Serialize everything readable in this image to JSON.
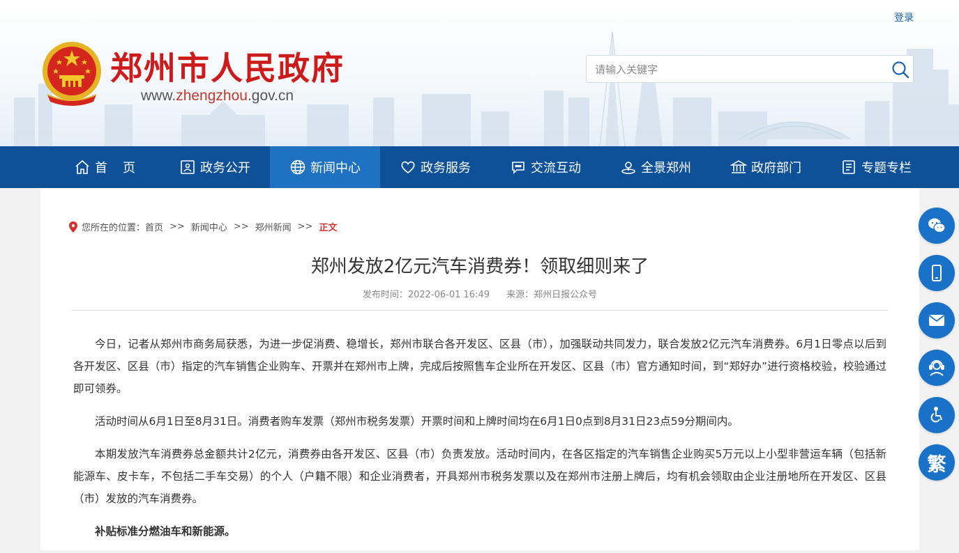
{
  "header": {
    "site_title": "郑州市人民政府",
    "domain_prefix": "www.",
    "domain_accent": "zhengzhou",
    "domain_suffix": ".gov.cn",
    "login_label": "登录",
    "search_placeholder": "请输入关键字",
    "search_icon": "search-icon"
  },
  "nav": {
    "items": [
      {
        "label": "首页",
        "icon": "home-icon"
      },
      {
        "label": "政务公开",
        "icon": "id-card-icon"
      },
      {
        "label": "新闻中心",
        "icon": "globe-icon",
        "active": true
      },
      {
        "label": "政务服务",
        "icon": "heart-icon"
      },
      {
        "label": "交流互动",
        "icon": "chat-icon"
      },
      {
        "label": "全景郑州",
        "icon": "panorama-icon"
      },
      {
        "label": "政府部门",
        "icon": "building-icon"
      },
      {
        "label": "专题专栏",
        "icon": "document-icon"
      }
    ]
  },
  "breadcrumb": {
    "prefix": "您所在的位置：",
    "items": [
      "首页",
      "新闻中心",
      "郑州新闻"
    ],
    "separator": ">>",
    "current": "正文"
  },
  "article": {
    "title": "郑州发放2亿元汽车消费券！领取细则来了",
    "publish_time": "发布时间：2022-06-01 16:49",
    "source": "来源：郑州日报公众号",
    "paragraphs": [
      "今日，记者从郑州市商务局获悉，为进一步促消费、稳增长，郑州市联合各开发区、区县（市），加强联动共同发力，联合发放2亿元汽车消费券。6月1日零点以后到各开发区、区县（市）指定的汽车销售企业购车、开票并在郑州市上牌，完成后按照售车企业所在开发区、区县（市）官方通知时间，到“郑好办”进行资格校验，校验通过即可领券。",
      "活动时间从6月1日至8月31日。消费者购车发票（郑州市税务发票）开票时间和上牌时间均在6月1日0点到8月31日23点59分期间内。",
      "本期发放汽车消费券总金额共计2亿元，消费券由各开发区、区县（市）负责发放。活动时间内，在各区指定的汽车销售企业购买5万元以上小型非营运车辆（包括新能源车、皮卡车，不包括二手车交易）的个人（户籍不限）和企业消费者，开具郑州市税务发票以及在郑州市注册上牌后，均有机会领取由企业注册地所在开发区、区县（市）发放的汽车消费券。"
    ],
    "subheading": "补贴标准分燃油车和新能源。"
  },
  "side_tools": {
    "items": [
      {
        "icon": "wechat-icon"
      },
      {
        "icon": "mobile-icon"
      },
      {
        "icon": "mail-icon"
      },
      {
        "icon": "customer-service-icon"
      },
      {
        "icon": "accessibility-icon"
      },
      {
        "icon": "traditional-chinese-icon",
        "text": "繁"
      }
    ]
  },
  "colors": {
    "brand_red": "#cd1a1a",
    "nav_blue": "#0e5199",
    "nav_active": "#1f72c1",
    "tool_blue": "#1a72c8",
    "breadcrumb_current": "#d43030"
  }
}
